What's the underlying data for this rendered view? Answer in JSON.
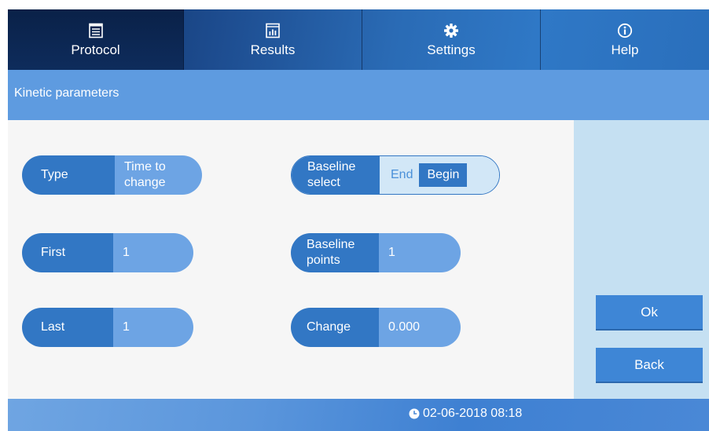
{
  "nav": {
    "tabs": [
      {
        "label": "Protocol",
        "icon": "protocol-icon",
        "active": true
      },
      {
        "label": "Results",
        "icon": "results-chart-icon",
        "active": false
      },
      {
        "label": "Settings",
        "icon": "gear-icon",
        "active": false
      },
      {
        "label": "Help",
        "icon": "info-icon",
        "active": false
      }
    ]
  },
  "page": {
    "title": "Kinetic parameters"
  },
  "params": {
    "type": {
      "label": "Type",
      "value_line1": "Time to",
      "value_line2": "change"
    },
    "first": {
      "label": "First",
      "value": "1"
    },
    "last": {
      "label": "Last",
      "value": "1"
    },
    "baseline_select": {
      "label_line1": "Baseline",
      "label_line2": "select",
      "options": [
        "End",
        "Begin"
      ],
      "selected": "Begin"
    },
    "baseline_points": {
      "label_line1": "Baseline",
      "label_line2": "points",
      "value": "1"
    },
    "change": {
      "label": "Change",
      "value": "0.000"
    }
  },
  "actions": {
    "ok": "Ok",
    "back": "Back"
  },
  "footer": {
    "datetime": "02-06-2018 08:18",
    "clock_icon": "clock-icon"
  },
  "colors": {
    "nav_dark": "#0b2a5c",
    "title_bar": "#5e9be0",
    "pill_key": "#3277c4",
    "pill_value": "#6da4e4",
    "sidebar": "#c5e0f2",
    "button": "#3e86d6"
  }
}
